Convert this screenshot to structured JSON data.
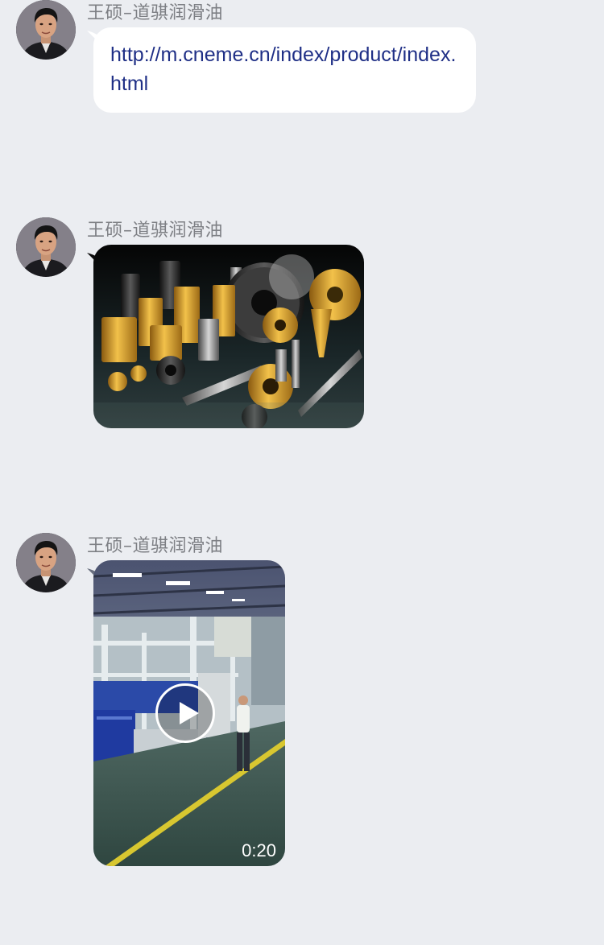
{
  "messages": [
    {
      "sender": "王硕–道骐润滑油",
      "type": "link",
      "text": "http://m.cneme.cn/index/product/index.html"
    },
    {
      "sender": "王硕–道骐润滑油",
      "type": "image",
      "image_description": "gear-cutting-tools-photo"
    },
    {
      "sender": "王硕–道骐润滑油",
      "type": "video",
      "duration": "0:20",
      "image_description": "factory-production-line-video"
    }
  ],
  "colors": {
    "background": "#ebedf1",
    "bubble": "#ffffff",
    "link": "#1f2f86",
    "sender": "#7d7f84"
  }
}
